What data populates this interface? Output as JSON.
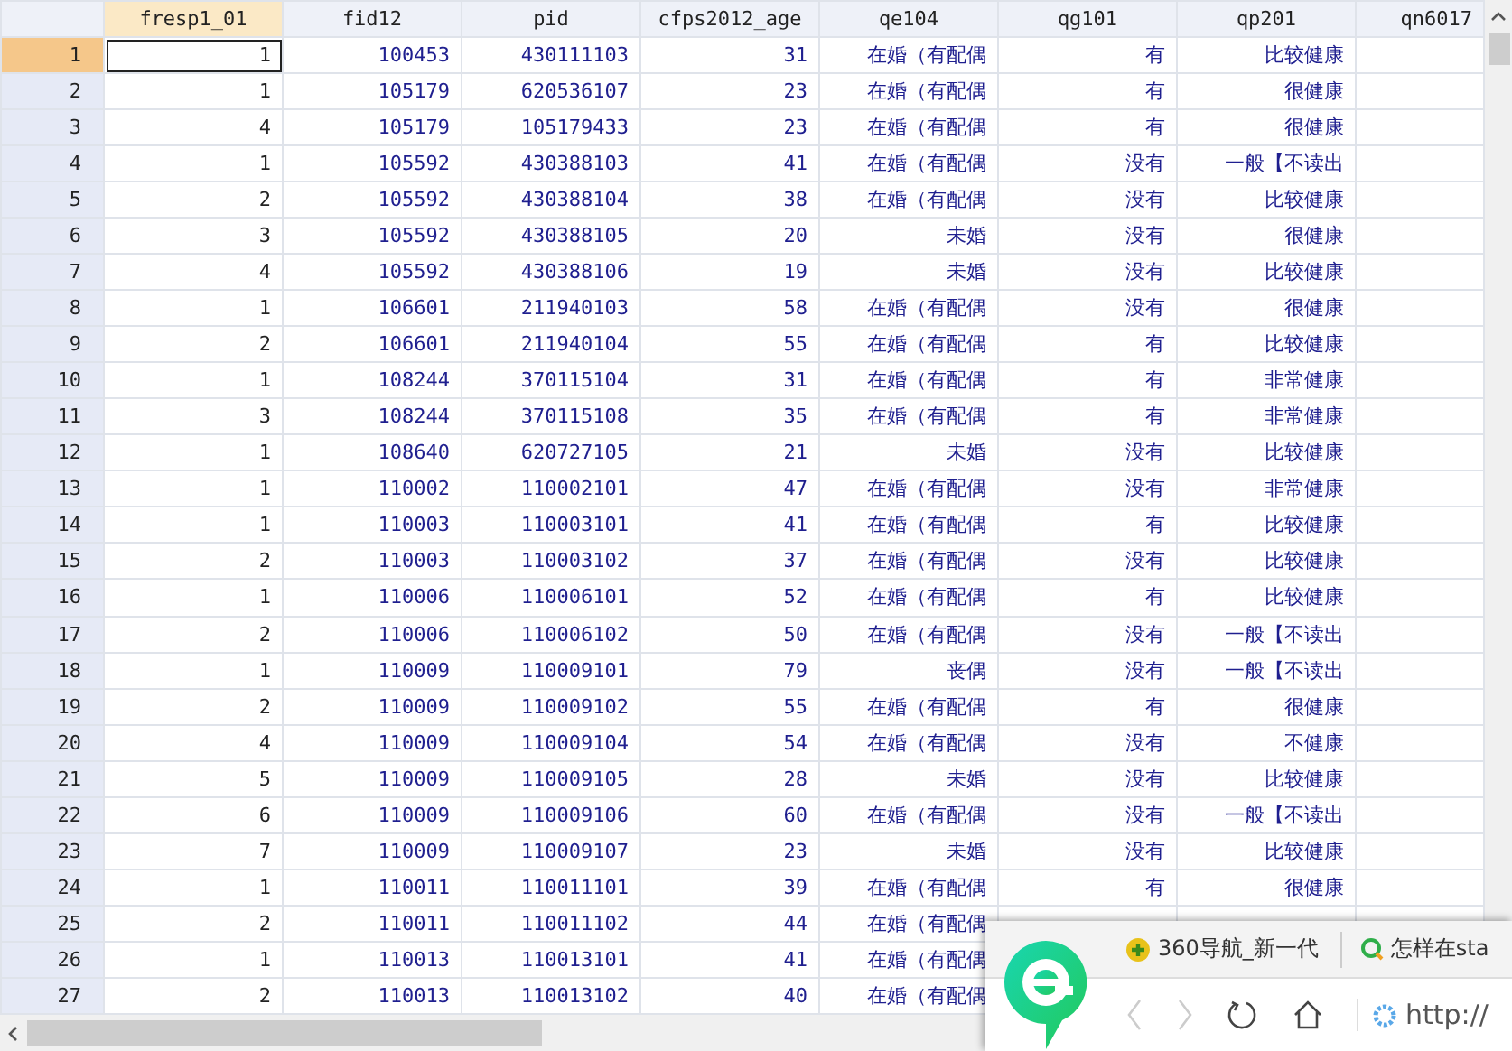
{
  "columns": [
    "fresp1_01",
    "fid12",
    "pid",
    "cfps2012_age",
    "qe104",
    "qg101",
    "qp201",
    "qn6017"
  ],
  "rows": [
    {
      "num": "1",
      "selected": true,
      "cells": [
        "1",
        "100453",
        "430111103",
        "31",
        "在婚（有配偶",
        "有",
        "比较健康"
      ]
    },
    {
      "num": "2",
      "selected": false,
      "cells": [
        "1",
        "105179",
        "620536107",
        "23",
        "在婚（有配偶",
        "有",
        "很健康"
      ]
    },
    {
      "num": "3",
      "selected": false,
      "cells": [
        "4",
        "105179",
        "105179433",
        "23",
        "在婚（有配偶",
        "有",
        "很健康"
      ]
    },
    {
      "num": "4",
      "selected": false,
      "cells": [
        "1",
        "105592",
        "430388103",
        "41",
        "在婚（有配偶",
        "没有",
        "一般【不读出"
      ]
    },
    {
      "num": "5",
      "selected": false,
      "cells": [
        "2",
        "105592",
        "430388104",
        "38",
        "在婚（有配偶",
        "没有",
        "比较健康"
      ]
    },
    {
      "num": "6",
      "selected": false,
      "cells": [
        "3",
        "105592",
        "430388105",
        "20",
        "未婚",
        "没有",
        "很健康"
      ]
    },
    {
      "num": "7",
      "selected": false,
      "cells": [
        "4",
        "105592",
        "430388106",
        "19",
        "未婚",
        "没有",
        "比较健康"
      ]
    },
    {
      "num": "8",
      "selected": false,
      "cells": [
        "1",
        "106601",
        "211940103",
        "58",
        "在婚（有配偶",
        "没有",
        "很健康"
      ]
    },
    {
      "num": "9",
      "selected": false,
      "cells": [
        "2",
        "106601",
        "211940104",
        "55",
        "在婚（有配偶",
        "有",
        "比较健康"
      ]
    },
    {
      "num": "10",
      "selected": false,
      "cells": [
        "1",
        "108244",
        "370115104",
        "31",
        "在婚（有配偶",
        "有",
        "非常健康"
      ]
    },
    {
      "num": "11",
      "selected": false,
      "cells": [
        "3",
        "108244",
        "370115108",
        "35",
        "在婚（有配偶",
        "有",
        "非常健康"
      ]
    },
    {
      "num": "12",
      "selected": false,
      "cells": [
        "1",
        "108640",
        "620727105",
        "21",
        "未婚",
        "没有",
        "比较健康"
      ]
    },
    {
      "num": "13",
      "selected": false,
      "cells": [
        "1",
        "110002",
        "110002101",
        "47",
        "在婚（有配偶",
        "没有",
        "非常健康"
      ]
    },
    {
      "num": "14",
      "selected": false,
      "cells": [
        "1",
        "110003",
        "110003101",
        "41",
        "在婚（有配偶",
        "有",
        "比较健康"
      ]
    },
    {
      "num": "15",
      "selected": false,
      "cells": [
        "2",
        "110003",
        "110003102",
        "37",
        "在婚（有配偶",
        "没有",
        "比较健康"
      ]
    },
    {
      "num": "16",
      "selected": false,
      "cells": [
        "1",
        "110006",
        "110006101",
        "52",
        "在婚（有配偶",
        "有",
        "比较健康"
      ]
    },
    {
      "num": "17",
      "selected": false,
      "cells": [
        "2",
        "110006",
        "110006102",
        "50",
        "在婚（有配偶",
        "没有",
        "一般【不读出"
      ]
    },
    {
      "num": "18",
      "selected": false,
      "cells": [
        "1",
        "110009",
        "110009101",
        "79",
        "丧偶",
        "没有",
        "一般【不读出"
      ]
    },
    {
      "num": "19",
      "selected": false,
      "cells": [
        "2",
        "110009",
        "110009102",
        "55",
        "在婚（有配偶",
        "有",
        "很健康"
      ]
    },
    {
      "num": "20",
      "selected": false,
      "cells": [
        "4",
        "110009",
        "110009104",
        "54",
        "在婚（有配偶",
        "没有",
        "不健康"
      ]
    },
    {
      "num": "21",
      "selected": false,
      "cells": [
        "5",
        "110009",
        "110009105",
        "28",
        "未婚",
        "没有",
        "比较健康"
      ]
    },
    {
      "num": "22",
      "selected": false,
      "cells": [
        "6",
        "110009",
        "110009106",
        "60",
        "在婚（有配偶",
        "没有",
        "一般【不读出"
      ]
    },
    {
      "num": "23",
      "selected": false,
      "cells": [
        "7",
        "110009",
        "110009107",
        "23",
        "未婚",
        "没有",
        "比较健康"
      ]
    },
    {
      "num": "24",
      "selected": false,
      "cells": [
        "1",
        "110011",
        "110011101",
        "39",
        "在婚（有配偶",
        "有",
        "很健康"
      ]
    },
    {
      "num": "25",
      "selected": false,
      "cells": [
        "2",
        "110011",
        "110011102",
        "44",
        "在婚（有配偶"
      ]
    },
    {
      "num": "26",
      "selected": false,
      "cells": [
        "1",
        "110013",
        "110013101",
        "41",
        "在婚（有配偶"
      ]
    },
    {
      "num": "27",
      "selected": false,
      "cells": [
        "2",
        "110013",
        "110013102",
        "40",
        "在婚（有配偶"
      ]
    }
  ],
  "popup": {
    "tabs": [
      "360导航_新一代",
      "怎样在sta"
    ],
    "address": "http://"
  }
}
